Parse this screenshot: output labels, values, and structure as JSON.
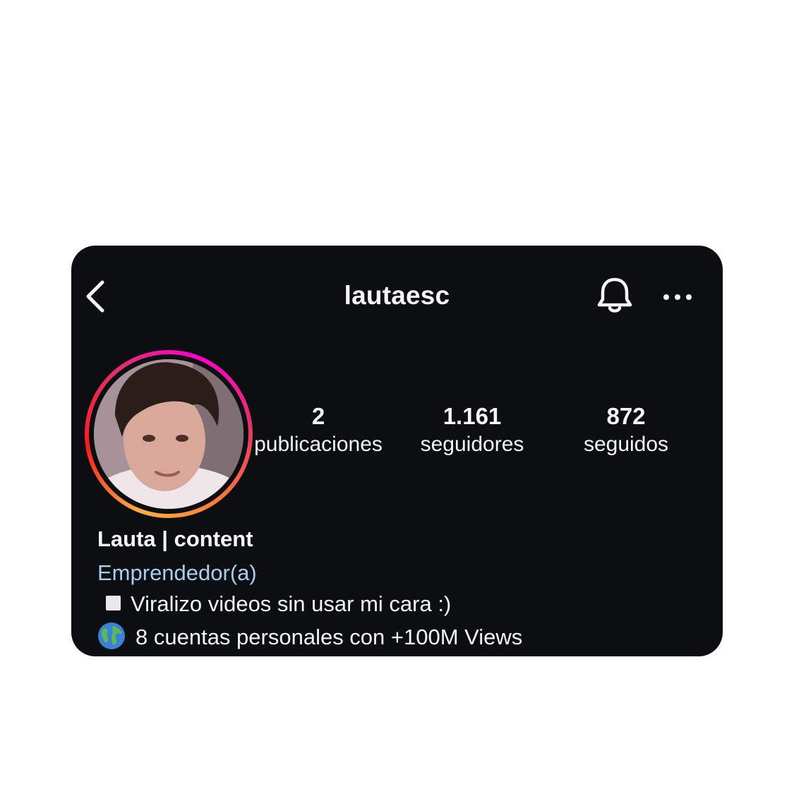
{
  "header": {
    "username": "lautaesc",
    "back_icon": "chevron-left-icon",
    "bell_icon": "bell-icon",
    "more_icon": "more-horizontal-icon"
  },
  "profile": {
    "stats": {
      "posts_value": "2",
      "posts_label": "publicaciones",
      "followers_value": "1.161",
      "followers_label": "seguidores",
      "following_value": "872",
      "following_label": "seguidos"
    },
    "display_name": "Lauta | content",
    "category": "Emprendedor(a)",
    "bio": [
      {
        "icon": "white-square-icon",
        "text": "Viralizo videos sin usar mi cara :)"
      },
      {
        "icon": "globe-icon",
        "text": "8 cuentas personales con +100M Views"
      }
    ]
  },
  "colors": {
    "background": "#0c0e12",
    "text": "#f5f5f5",
    "category": "#a9cdef",
    "story_ring_start": "#fcaf45",
    "story_ring_end": "#ff00cc"
  }
}
